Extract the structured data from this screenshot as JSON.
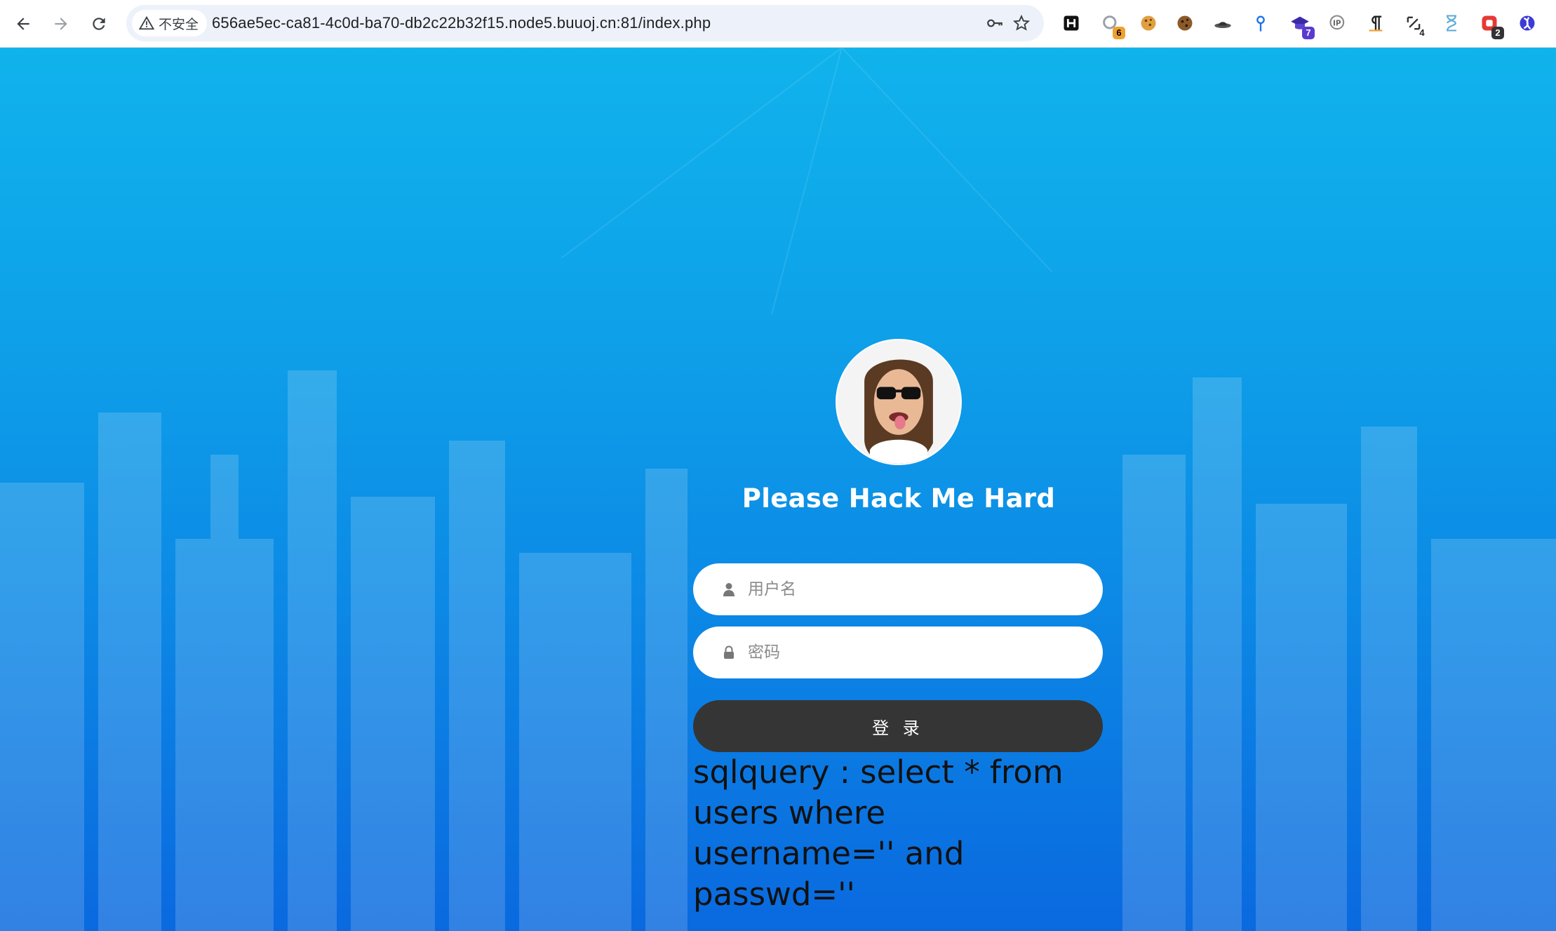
{
  "browser": {
    "security_label": "不安全",
    "url": "656ae5ec-ca81-4c0d-ba70-db2c22b32f15.node5.buuoj.cn:81/index.php",
    "extensions": [
      {
        "name": "hackbar",
        "badge": ""
      },
      {
        "name": "wappalyzer",
        "badge": "6"
      },
      {
        "name": "cookie-editor",
        "badge": ""
      },
      {
        "name": "cookie-manager",
        "badge": ""
      },
      {
        "name": "proxy",
        "badge": ""
      },
      {
        "name": "location-pin",
        "badge": ""
      },
      {
        "name": "mortarboard",
        "badge": "7"
      },
      {
        "name": "ip-lookup",
        "badge": ""
      },
      {
        "name": "pilcrow",
        "badge": ""
      },
      {
        "name": "link-tool",
        "badge": "4"
      },
      {
        "name": "hourglass",
        "badge": ""
      },
      {
        "name": "red-extension",
        "badge": "2"
      },
      {
        "name": "globe-extension",
        "badge": ""
      }
    ]
  },
  "login": {
    "title": "Please Hack Me Hard",
    "username_placeholder": "用户名",
    "password_placeholder": "密码",
    "submit_label": "登 录"
  },
  "sql": {
    "line1": "sqlquery : select * from",
    "line2": "users where",
    "line3": "username='' and",
    "line4": "passwd=''"
  },
  "colors": {
    "page_top": "#10b3ec",
    "page_bottom": "#0a69df",
    "button": "#353535",
    "omnibox": "#edf2fa"
  }
}
